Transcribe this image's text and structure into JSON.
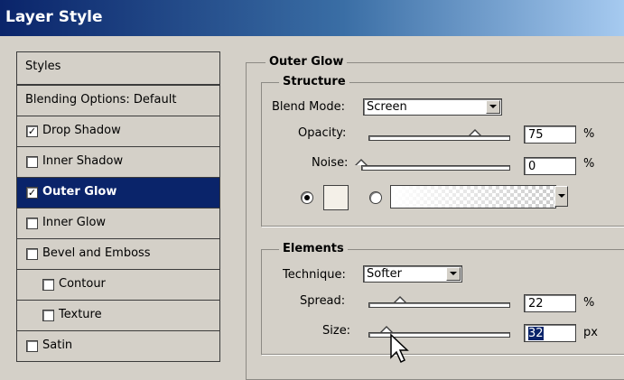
{
  "window": {
    "title": "Layer Style"
  },
  "styles_panel": {
    "header": "Styles",
    "blending_options": "Blending Options: Default",
    "items": [
      {
        "label": "Drop Shadow",
        "checked": true,
        "selected": false
      },
      {
        "label": "Inner Shadow",
        "checked": false,
        "selected": false
      },
      {
        "label": "Outer Glow",
        "checked": true,
        "selected": true
      },
      {
        "label": "Inner Glow",
        "checked": false,
        "selected": false
      },
      {
        "label": "Bevel and Emboss",
        "checked": false,
        "selected": false
      },
      {
        "label": "Contour",
        "checked": false,
        "selected": false
      },
      {
        "label": "Texture",
        "checked": false,
        "selected": false
      },
      {
        "label": "Satin",
        "checked": false,
        "selected": false
      }
    ]
  },
  "outer_glow": {
    "title": "Outer Glow",
    "structure": {
      "title": "Structure",
      "blend_mode_label": "Blend Mode:",
      "blend_mode_value": "Screen",
      "opacity_label": "Opacity:",
      "opacity_value": "75",
      "opacity_fraction": 0.75,
      "opacity_unit": "%",
      "noise_label": "Noise:",
      "noise_value": "0",
      "noise_fraction": 0.0,
      "noise_unit": "%"
    },
    "elements": {
      "title": "Elements",
      "technique_label": "Technique:",
      "technique_value": "Softer",
      "spread_label": "Spread:",
      "spread_value": "22",
      "spread_fraction": 0.22,
      "spread_unit": "%",
      "size_label": "Size:",
      "size_value": "32",
      "size_fraction": 0.13,
      "size_unit": "px"
    }
  },
  "colors": {
    "selection": "#0a246a",
    "panel": "#d4d0c8",
    "title_start": "#0a246a",
    "title_end": "#a6caf0"
  },
  "icons": {
    "checkbox_checked": "check-mark",
    "cursor": "arrow-pointer-icon",
    "dropdown": "chevron-down-icon"
  }
}
